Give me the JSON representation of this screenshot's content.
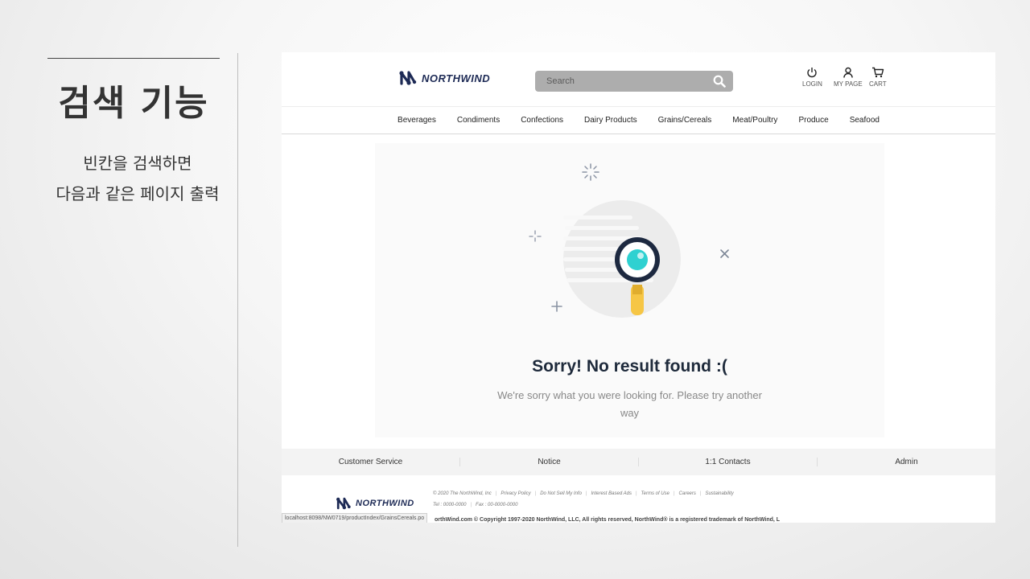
{
  "slide": {
    "title": "검색 기능",
    "desc_line1": "빈칸을 검색하면",
    "desc_line2": "다음과 같은 페이지 출력"
  },
  "header": {
    "logo_text": "NORTHWIND",
    "search_placeholder": "Search",
    "login_label": "LOGIN",
    "mypage_label": "MY PAGE",
    "cart_label": "CART"
  },
  "nav": {
    "items": [
      "Beverages",
      "Condiments",
      "Confections",
      "Dairy Products",
      "Grains/Cereals",
      "Meat/Poultry",
      "Produce",
      "Seafood"
    ]
  },
  "result": {
    "title": "Sorry! No result found :(",
    "message": "We're sorry what you were looking for. Please try another way"
  },
  "footer": {
    "links": [
      "Customer Service",
      "Notice",
      "1:1 Contacts",
      "Admin"
    ],
    "legal": [
      "© 2020 The NorthWind, Inc",
      "Privacy Policy",
      "Do Not Sell My Info",
      "Interest Based Ads",
      "Terms of Use",
      "Careers",
      "Sustainability"
    ],
    "contact": [
      "Tel : 0000-0000",
      "Fax : 00-0000-0000"
    ],
    "copyright": "orthWind.com © Copyright 1997-2020 NorthWind, LLC, All rights reserved, NorthWind® is a registered trademark of NorthWind, L",
    "logo_text": "NORTHWIND"
  },
  "status_url": "localhost:8098/NW0719/productIndex/GrainsCereals.po",
  "colors": {
    "brand": "#1d2a55",
    "accent": "#2fd1d1",
    "handle": "#f6c645"
  }
}
